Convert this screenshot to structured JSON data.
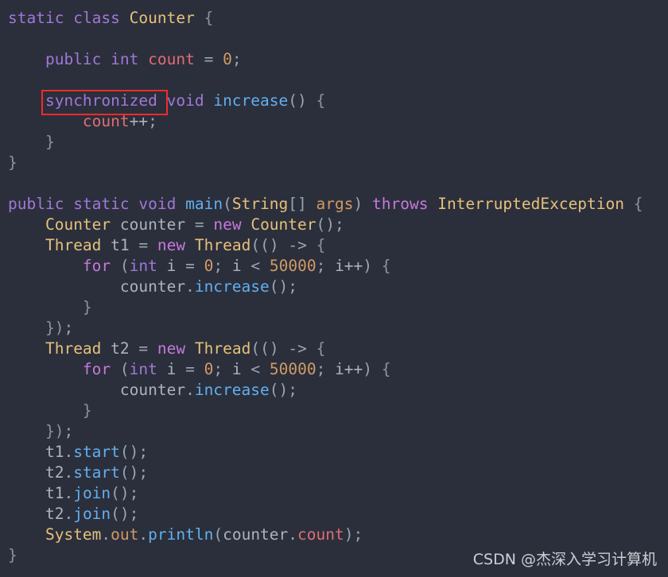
{
  "editor": {
    "language": "java",
    "background_color": "#2b2f3b",
    "default_text_color": "#b9bfca",
    "font_size_px": 19.5,
    "line_height_px": 26
  },
  "colors": {
    "keyword": "#a077d8",
    "keyword_alt": "#c678dd",
    "type": "#e5c07b",
    "method": "#61afef",
    "number": "#d19a66",
    "field": "#e06c75",
    "identifier": "#abb2bf",
    "punctuation": "#9aa4b2",
    "brace": "#8b93a1",
    "highlight_box": "#f52a2a",
    "watermark": "#d9dde3"
  },
  "annotation": {
    "highlight_token": "synchronized",
    "shape": "rectangle",
    "color": "#f52a2a"
  },
  "watermark": {
    "text": "CSDN @杰深入学习计算机"
  },
  "code": {
    "plain_text": "static class Counter {\n\n    public int count = 0;\n\n    synchronized void increase() {\n        count++;\n    }\n}\n\npublic static void main(String[] args) throws InterruptedException {\n    Counter counter = new Counter();\n    Thread t1 = new Thread(() -> {\n        for (int i = 0; i < 50000; i++) {\n            counter.increase();\n        }\n    });\n    Thread t2 = new Thread(() -> {\n        for (int i = 0; i < 50000; i++) {\n            counter.increase();\n        }\n    });\n    t1.start();\n    t2.start();\n    t1.join();\n    t2.join();\n    System.out.println(counter.count);\n}",
    "lines": [
      {
        "n": 1,
        "text": "static class Counter {",
        "tokens": [
          {
            "t": "static",
            "c": "kw"
          },
          {
            "t": " ",
            "c": "var"
          },
          {
            "t": "class",
            "c": "kw"
          },
          {
            "t": " ",
            "c": "var"
          },
          {
            "t": "Counter",
            "c": "type"
          },
          {
            "t": " ",
            "c": "var"
          },
          {
            "t": "{",
            "c": "brc"
          }
        ]
      },
      {
        "n": 2,
        "text": "",
        "tokens": []
      },
      {
        "n": 3,
        "text": "    public int count = 0;",
        "tokens": [
          {
            "t": "    ",
            "c": "var"
          },
          {
            "t": "public",
            "c": "kw"
          },
          {
            "t": " ",
            "c": "var"
          },
          {
            "t": "int",
            "c": "kw"
          },
          {
            "t": " ",
            "c": "var"
          },
          {
            "t": "count",
            "c": "fld"
          },
          {
            "t": " ",
            "c": "var"
          },
          {
            "t": "=",
            "c": "punc"
          },
          {
            "t": " ",
            "c": "var"
          },
          {
            "t": "0",
            "c": "num"
          },
          {
            "t": ";",
            "c": "punc"
          }
        ]
      },
      {
        "n": 4,
        "text": "",
        "tokens": []
      },
      {
        "n": 5,
        "text": "    synchronized void increase() {",
        "tokens": [
          {
            "t": "    ",
            "c": "var"
          },
          {
            "t": "synchronized",
            "c": "kw"
          },
          {
            "t": " ",
            "c": "var"
          },
          {
            "t": "void",
            "c": "kw"
          },
          {
            "t": " ",
            "c": "var"
          },
          {
            "t": "increase",
            "c": "fn"
          },
          {
            "t": "()",
            "c": "punc"
          },
          {
            "t": " ",
            "c": "var"
          },
          {
            "t": "{",
            "c": "brc"
          }
        ]
      },
      {
        "n": 6,
        "text": "        count++;",
        "tokens": [
          {
            "t": "        ",
            "c": "var"
          },
          {
            "t": "count",
            "c": "fld"
          },
          {
            "t": "++",
            "c": "var"
          },
          {
            "t": ";",
            "c": "punc"
          }
        ]
      },
      {
        "n": 7,
        "text": "    }",
        "tokens": [
          {
            "t": "    ",
            "c": "var"
          },
          {
            "t": "}",
            "c": "brc"
          }
        ]
      },
      {
        "n": 8,
        "text": "}",
        "tokens": [
          {
            "t": "}",
            "c": "brc"
          }
        ]
      },
      {
        "n": 9,
        "text": "",
        "tokens": []
      },
      {
        "n": 10,
        "text": "public static void main(String[] args) throws InterruptedException {",
        "tokens": [
          {
            "t": "public",
            "c": "kw"
          },
          {
            "t": " ",
            "c": "var"
          },
          {
            "t": "static",
            "c": "kw"
          },
          {
            "t": " ",
            "c": "var"
          },
          {
            "t": "void",
            "c": "kw"
          },
          {
            "t": " ",
            "c": "var"
          },
          {
            "t": "main",
            "c": "fn"
          },
          {
            "t": "(",
            "c": "punc"
          },
          {
            "t": "String",
            "c": "type"
          },
          {
            "t": "[]",
            "c": "punc"
          },
          {
            "t": " ",
            "c": "var"
          },
          {
            "t": "args",
            "c": "num"
          },
          {
            "t": ")",
            "c": "punc"
          },
          {
            "t": " ",
            "c": "var"
          },
          {
            "t": "throws",
            "c": "kw2"
          },
          {
            "t": " ",
            "c": "var"
          },
          {
            "t": "InterruptedException",
            "c": "type"
          },
          {
            "t": " ",
            "c": "var"
          },
          {
            "t": "{",
            "c": "brc"
          }
        ]
      },
      {
        "n": 11,
        "text": "    Counter counter = new Counter();",
        "tokens": [
          {
            "t": "    ",
            "c": "var"
          },
          {
            "t": "Counter",
            "c": "type"
          },
          {
            "t": " ",
            "c": "var"
          },
          {
            "t": "counter",
            "c": "var"
          },
          {
            "t": " ",
            "c": "var"
          },
          {
            "t": "=",
            "c": "punc"
          },
          {
            "t": " ",
            "c": "var"
          },
          {
            "t": "new",
            "c": "kw2"
          },
          {
            "t": " ",
            "c": "var"
          },
          {
            "t": "Counter",
            "c": "type"
          },
          {
            "t": "()",
            "c": "punc"
          },
          {
            "t": ";",
            "c": "punc"
          }
        ]
      },
      {
        "n": 12,
        "text": "    Thread t1 = new Thread(() -> {",
        "tokens": [
          {
            "t": "    ",
            "c": "var"
          },
          {
            "t": "Thread",
            "c": "type"
          },
          {
            "t": " ",
            "c": "var"
          },
          {
            "t": "t1",
            "c": "var"
          },
          {
            "t": " ",
            "c": "var"
          },
          {
            "t": "=",
            "c": "punc"
          },
          {
            "t": " ",
            "c": "var"
          },
          {
            "t": "new",
            "c": "kw2"
          },
          {
            "t": " ",
            "c": "var"
          },
          {
            "t": "Thread",
            "c": "type"
          },
          {
            "t": "(()",
            "c": "punc"
          },
          {
            "t": " ",
            "c": "var"
          },
          {
            "t": "->",
            "c": "punc"
          },
          {
            "t": " ",
            "c": "var"
          },
          {
            "t": "{",
            "c": "brc"
          }
        ]
      },
      {
        "n": 13,
        "text": "        for (int i = 0; i < 50000; i++) {",
        "tokens": [
          {
            "t": "        ",
            "c": "var"
          },
          {
            "t": "for",
            "c": "kw2"
          },
          {
            "t": " ",
            "c": "var"
          },
          {
            "t": "(",
            "c": "punc"
          },
          {
            "t": "int",
            "c": "kw"
          },
          {
            "t": " ",
            "c": "var"
          },
          {
            "t": "i",
            "c": "var"
          },
          {
            "t": " ",
            "c": "var"
          },
          {
            "t": "=",
            "c": "punc"
          },
          {
            "t": " ",
            "c": "var"
          },
          {
            "t": "0",
            "c": "num"
          },
          {
            "t": "; ",
            "c": "punc"
          },
          {
            "t": "i",
            "c": "var"
          },
          {
            "t": " ",
            "c": "var"
          },
          {
            "t": "<",
            "c": "punc"
          },
          {
            "t": " ",
            "c": "var"
          },
          {
            "t": "50000",
            "c": "num"
          },
          {
            "t": "; ",
            "c": "punc"
          },
          {
            "t": "i++",
            "c": "var"
          },
          {
            "t": ")",
            "c": "punc"
          },
          {
            "t": " ",
            "c": "var"
          },
          {
            "t": "{",
            "c": "brc"
          }
        ]
      },
      {
        "n": 14,
        "text": "            counter.increase();",
        "tokens": [
          {
            "t": "            ",
            "c": "var"
          },
          {
            "t": "counter",
            "c": "var"
          },
          {
            "t": ".",
            "c": "punc"
          },
          {
            "t": "increase",
            "c": "fn"
          },
          {
            "t": "()",
            "c": "punc"
          },
          {
            "t": ";",
            "c": "punc"
          }
        ]
      },
      {
        "n": 15,
        "text": "        }",
        "tokens": [
          {
            "t": "        ",
            "c": "var"
          },
          {
            "t": "}",
            "c": "brc"
          }
        ]
      },
      {
        "n": 16,
        "text": "    });",
        "tokens": [
          {
            "t": "    ",
            "c": "var"
          },
          {
            "t": "})",
            "c": "brc"
          },
          {
            "t": ";",
            "c": "punc"
          }
        ]
      },
      {
        "n": 17,
        "text": "    Thread t2 = new Thread(() -> {",
        "tokens": [
          {
            "t": "    ",
            "c": "var"
          },
          {
            "t": "Thread",
            "c": "type"
          },
          {
            "t": " ",
            "c": "var"
          },
          {
            "t": "t2",
            "c": "var"
          },
          {
            "t": " ",
            "c": "var"
          },
          {
            "t": "=",
            "c": "punc"
          },
          {
            "t": " ",
            "c": "var"
          },
          {
            "t": "new",
            "c": "kw2"
          },
          {
            "t": " ",
            "c": "var"
          },
          {
            "t": "Thread",
            "c": "type"
          },
          {
            "t": "(()",
            "c": "punc"
          },
          {
            "t": " ",
            "c": "var"
          },
          {
            "t": "->",
            "c": "punc"
          },
          {
            "t": " ",
            "c": "var"
          },
          {
            "t": "{",
            "c": "brc"
          }
        ]
      },
      {
        "n": 18,
        "text": "        for (int i = 0; i < 50000; i++) {",
        "tokens": [
          {
            "t": "        ",
            "c": "var"
          },
          {
            "t": "for",
            "c": "kw2"
          },
          {
            "t": " ",
            "c": "var"
          },
          {
            "t": "(",
            "c": "punc"
          },
          {
            "t": "int",
            "c": "kw"
          },
          {
            "t": " ",
            "c": "var"
          },
          {
            "t": "i",
            "c": "var"
          },
          {
            "t": " ",
            "c": "var"
          },
          {
            "t": "=",
            "c": "punc"
          },
          {
            "t": " ",
            "c": "var"
          },
          {
            "t": "0",
            "c": "num"
          },
          {
            "t": "; ",
            "c": "punc"
          },
          {
            "t": "i",
            "c": "var"
          },
          {
            "t": " ",
            "c": "var"
          },
          {
            "t": "<",
            "c": "punc"
          },
          {
            "t": " ",
            "c": "var"
          },
          {
            "t": "50000",
            "c": "num"
          },
          {
            "t": "; ",
            "c": "punc"
          },
          {
            "t": "i++",
            "c": "var"
          },
          {
            "t": ")",
            "c": "punc"
          },
          {
            "t": " ",
            "c": "var"
          },
          {
            "t": "{",
            "c": "brc"
          }
        ]
      },
      {
        "n": 19,
        "text": "            counter.increase();",
        "tokens": [
          {
            "t": "            ",
            "c": "var"
          },
          {
            "t": "counter",
            "c": "var"
          },
          {
            "t": ".",
            "c": "punc"
          },
          {
            "t": "increase",
            "c": "fn"
          },
          {
            "t": "()",
            "c": "punc"
          },
          {
            "t": ";",
            "c": "punc"
          }
        ]
      },
      {
        "n": 20,
        "text": "        }",
        "tokens": [
          {
            "t": "        ",
            "c": "var"
          },
          {
            "t": "}",
            "c": "brc"
          }
        ]
      },
      {
        "n": 21,
        "text": "    });",
        "tokens": [
          {
            "t": "    ",
            "c": "var"
          },
          {
            "t": "})",
            "c": "brc"
          },
          {
            "t": ";",
            "c": "punc"
          }
        ]
      },
      {
        "n": 22,
        "text": "    t1.start();",
        "tokens": [
          {
            "t": "    ",
            "c": "var"
          },
          {
            "t": "t1",
            "c": "var"
          },
          {
            "t": ".",
            "c": "punc"
          },
          {
            "t": "start",
            "c": "fn"
          },
          {
            "t": "()",
            "c": "punc"
          },
          {
            "t": ";",
            "c": "punc"
          }
        ]
      },
      {
        "n": 23,
        "text": "    t2.start();",
        "tokens": [
          {
            "t": "    ",
            "c": "var"
          },
          {
            "t": "t2",
            "c": "var"
          },
          {
            "t": ".",
            "c": "punc"
          },
          {
            "t": "start",
            "c": "fn"
          },
          {
            "t": "()",
            "c": "punc"
          },
          {
            "t": ";",
            "c": "punc"
          }
        ]
      },
      {
        "n": 24,
        "text": "    t1.join();",
        "tokens": [
          {
            "t": "    ",
            "c": "var"
          },
          {
            "t": "t1",
            "c": "var"
          },
          {
            "t": ".",
            "c": "punc"
          },
          {
            "t": "join",
            "c": "fn"
          },
          {
            "t": "()",
            "c": "punc"
          },
          {
            "t": ";",
            "c": "punc"
          }
        ]
      },
      {
        "n": 25,
        "text": "    t2.join();",
        "tokens": [
          {
            "t": "    ",
            "c": "var"
          },
          {
            "t": "t2",
            "c": "var"
          },
          {
            "t": ".",
            "c": "punc"
          },
          {
            "t": "join",
            "c": "fn"
          },
          {
            "t": "()",
            "c": "punc"
          },
          {
            "t": ";",
            "c": "punc"
          }
        ]
      },
      {
        "n": 26,
        "text": "    System.out.println(counter.count);",
        "tokens": [
          {
            "t": "    ",
            "c": "var"
          },
          {
            "t": "System",
            "c": "type"
          },
          {
            "t": ".",
            "c": "punc"
          },
          {
            "t": "out",
            "c": "num"
          },
          {
            "t": ".",
            "c": "punc"
          },
          {
            "t": "println",
            "c": "fn"
          },
          {
            "t": "(",
            "c": "punc"
          },
          {
            "t": "counter",
            "c": "var"
          },
          {
            "t": ".",
            "c": "punc"
          },
          {
            "t": "count",
            "c": "fld"
          },
          {
            "t": ")",
            "c": "punc"
          },
          {
            "t": ";",
            "c": "punc"
          }
        ]
      },
      {
        "n": 27,
        "text": "}",
        "tokens": [
          {
            "t": "}",
            "c": "brc"
          }
        ]
      }
    ]
  }
}
